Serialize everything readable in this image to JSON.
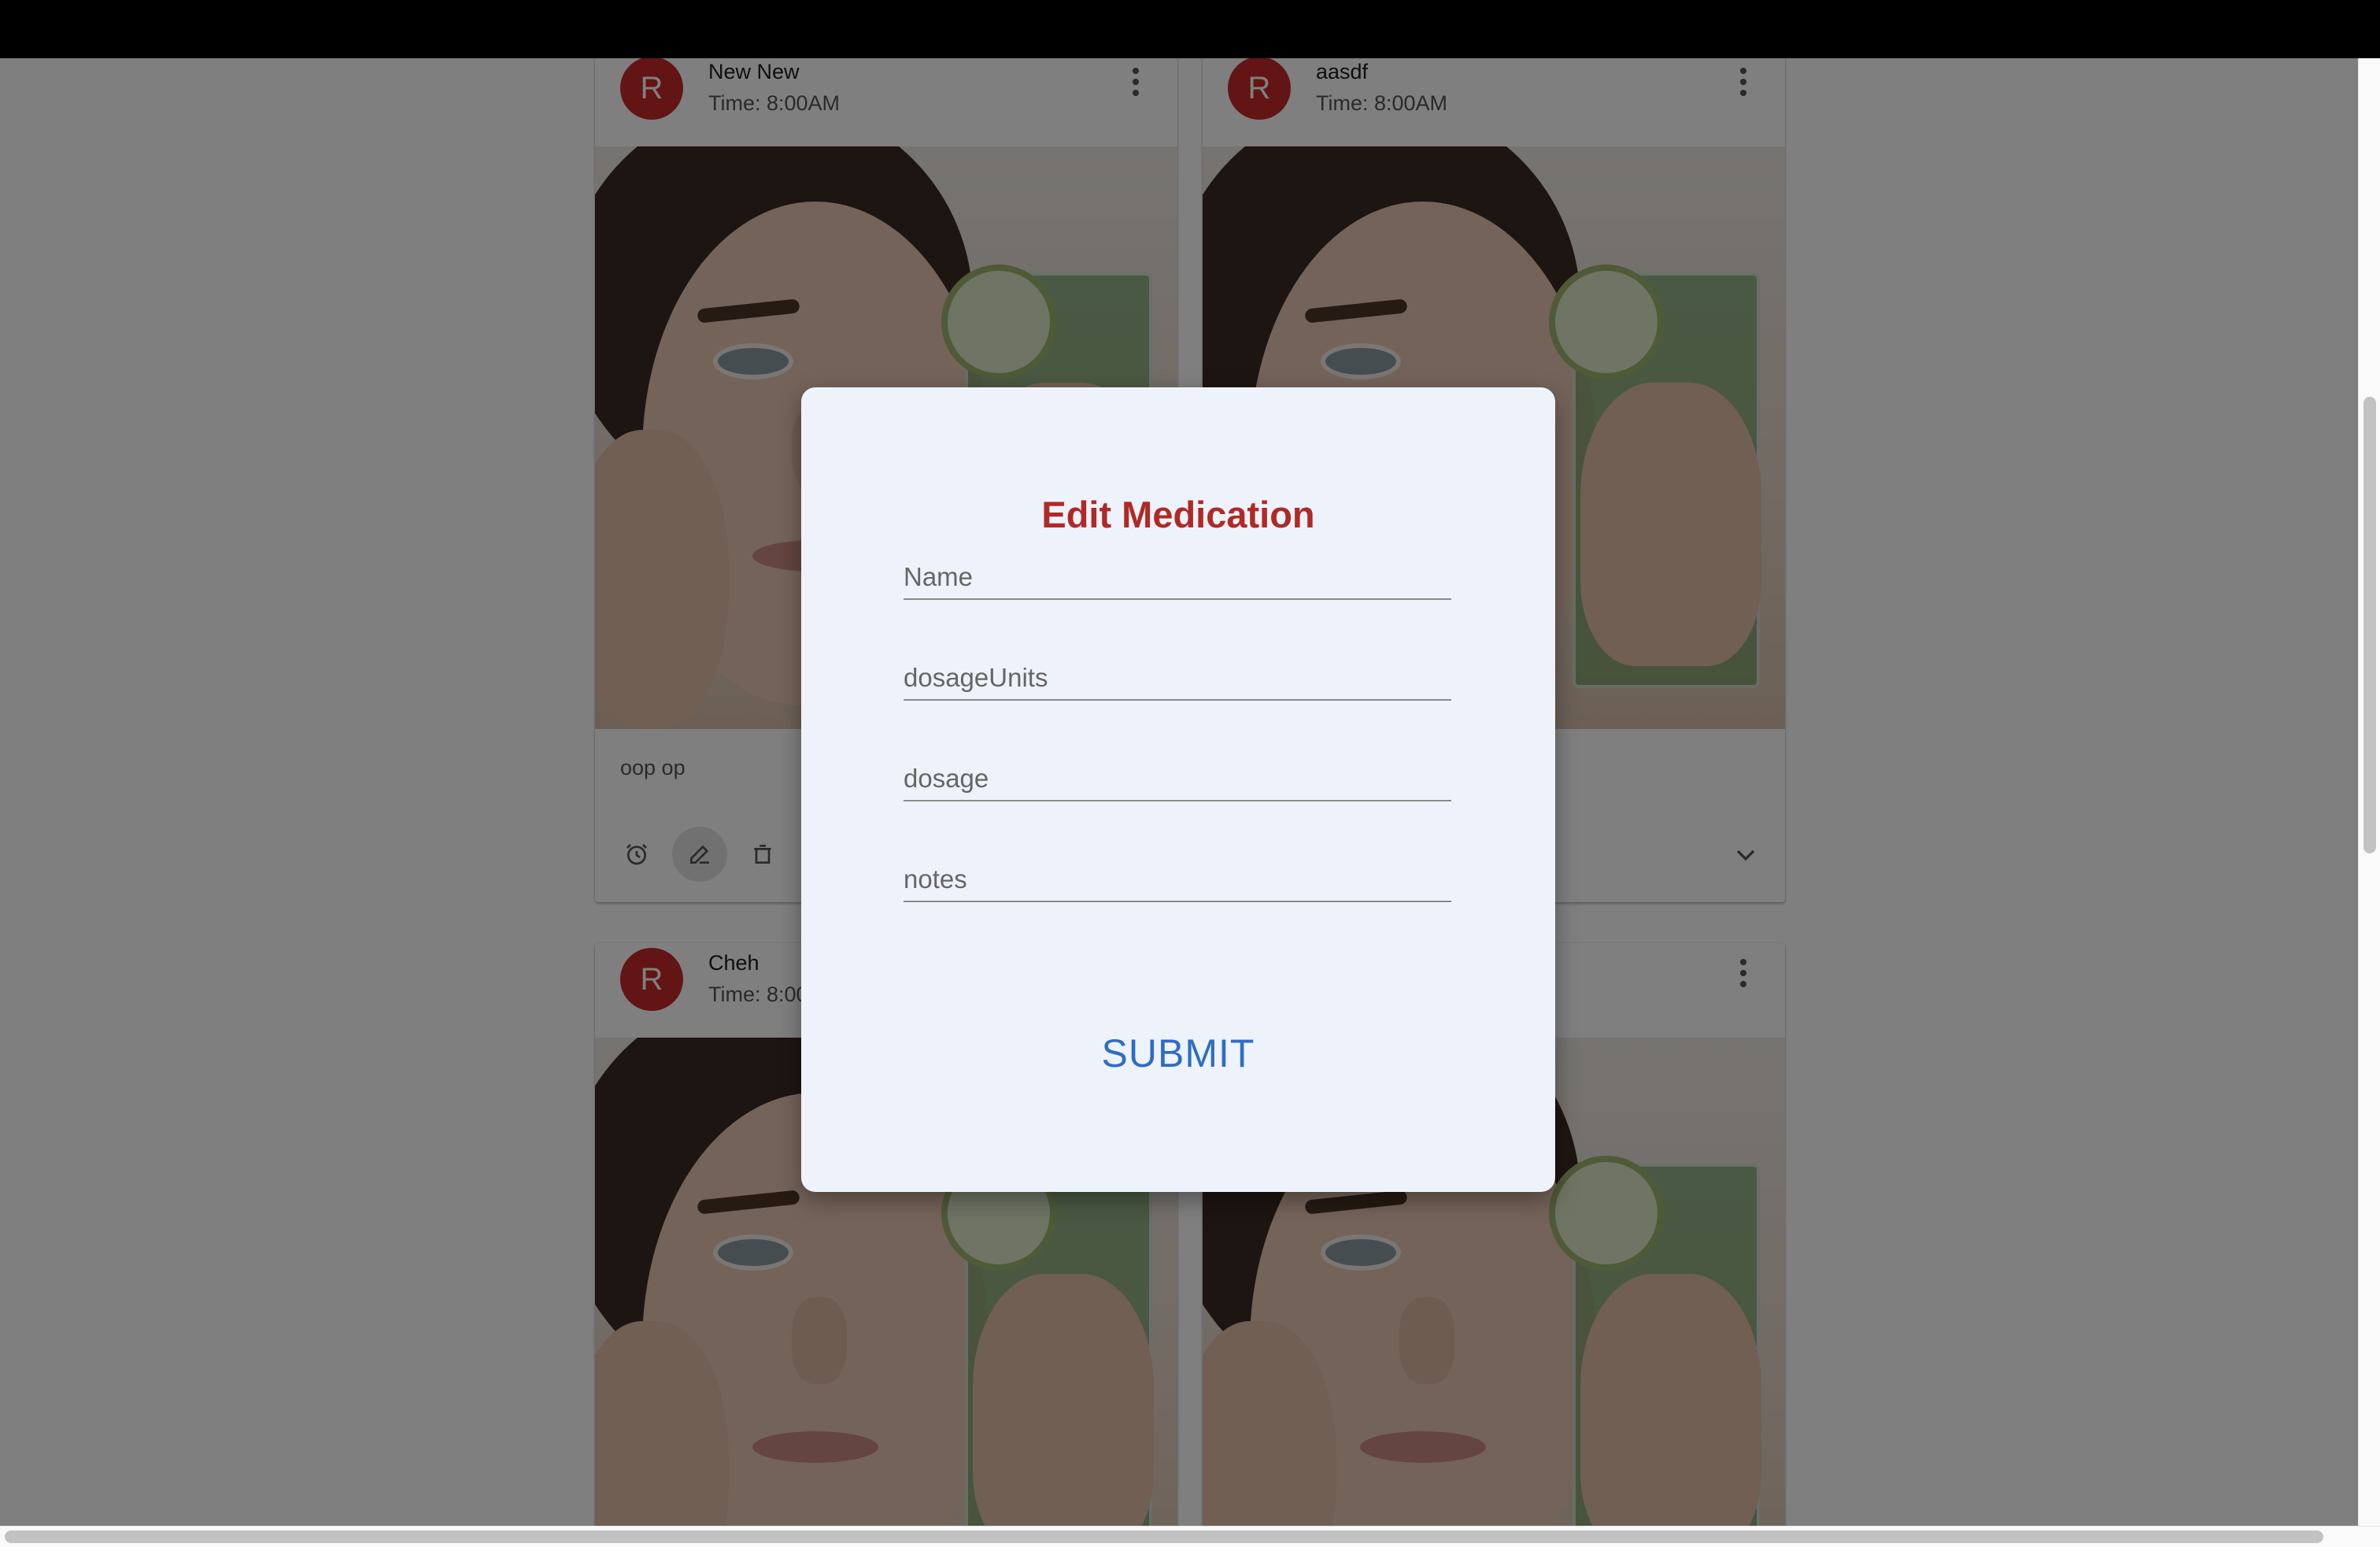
{
  "cards": [
    {
      "avatar": "R",
      "title": "New New",
      "time": "Time: 8:00AM",
      "text": "oop op"
    },
    {
      "avatar": "R",
      "title": "aasdf",
      "time": "Time: 8:00AM",
      "text": ""
    },
    {
      "avatar": "R",
      "title": "Cheh",
      "time": "Time: 8:00AM",
      "text": ""
    },
    {
      "avatar": "R",
      "title": "",
      "time": "",
      "text": ""
    }
  ],
  "modal": {
    "title": "Edit Medication",
    "fields": {
      "name": {
        "placeholder": "Name",
        "value": ""
      },
      "dosage_units": {
        "placeholder": "dosageUnits",
        "value": ""
      },
      "dosage": {
        "placeholder": "dosage",
        "value": ""
      },
      "notes": {
        "placeholder": "notes",
        "value": ""
      }
    },
    "submit_label": "SUBMIT"
  },
  "colors": {
    "avatar": "#c62828",
    "modal_title": "#b02a25",
    "submit": "#2f6dc4",
    "modal_background": "#eef3fb"
  },
  "icons": [
    "kebab-menu-icon",
    "alarm-icon",
    "edit-icon",
    "delete-icon",
    "chevron-down-icon"
  ]
}
